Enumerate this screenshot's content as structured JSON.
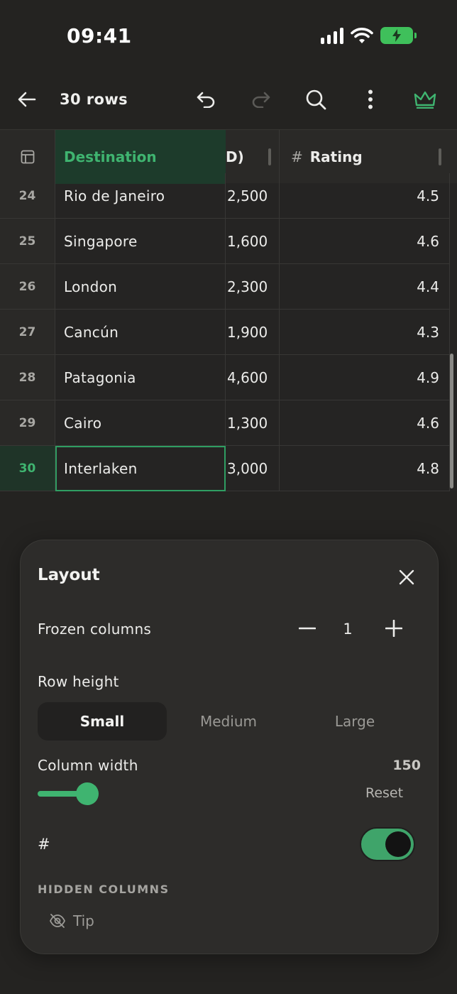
{
  "status_bar": {
    "time": "09:41"
  },
  "toolbar": {
    "title": "30 rows",
    "icons": [
      "back-arrow-icon",
      "undo-icon",
      "redo-icon",
      "search-icon",
      "more-vertical-icon",
      "crown-icon"
    ],
    "accent_color": "#3fb470"
  },
  "grid": {
    "headers": {
      "destination": "Destination",
      "price_partial": "D)",
      "rating_hash": "#",
      "rating": "Rating"
    },
    "rows": [
      {
        "num": "24",
        "destination": "Rio de Janeiro",
        "price": "2,500",
        "rating": "4.5"
      },
      {
        "num": "25",
        "destination": "Singapore",
        "price": "1,600",
        "rating": "4.6"
      },
      {
        "num": "26",
        "destination": "London",
        "price": "2,300",
        "rating": "4.4"
      },
      {
        "num": "27",
        "destination": "Cancún",
        "price": "1,900",
        "rating": "4.3"
      },
      {
        "num": "28",
        "destination": "Patagonia",
        "price": "4,600",
        "rating": "4.9"
      },
      {
        "num": "29",
        "destination": "Cairo",
        "price": "1,300",
        "rating": "4.6"
      },
      {
        "num": "30",
        "destination": "Interlaken",
        "price": "3,000",
        "rating": "4.8"
      }
    ],
    "active_row": "30"
  },
  "layout_sheet": {
    "title": "Layout",
    "frozen_columns_label": "Frozen columns",
    "frozen_columns_value": "1",
    "row_height_label": "Row height",
    "row_height_options": [
      "Small",
      "Medium",
      "Large"
    ],
    "row_height_selected": "Small",
    "column_width_label": "Column width",
    "column_width_value": "150",
    "reset_label": "Reset",
    "row_number_label": "#",
    "row_number_toggle_on": true,
    "hidden_columns_heading": "HIDDEN COLUMNS",
    "hidden_columns": [
      "Tip"
    ]
  }
}
